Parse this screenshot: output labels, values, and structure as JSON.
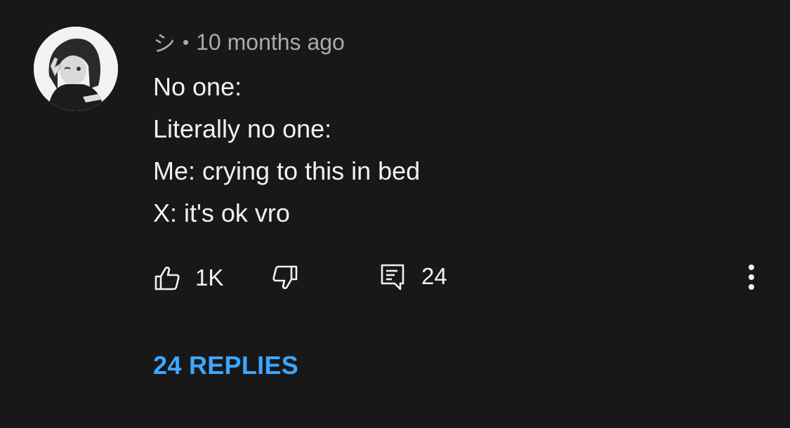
{
  "comment": {
    "author": "シ",
    "separator": "•",
    "timestamp": "10 months ago",
    "lines": [
      "No one:",
      "Literally no one:",
      "Me: crying to this in bed",
      "X: it's ok vro"
    ],
    "like_count": "1K",
    "reply_count": "24",
    "replies_link": "24 REPLIES"
  },
  "colors": {
    "background": "#181818",
    "text": "#f1f1f1",
    "meta_text": "#aaaaaa",
    "link": "#3ea6ff"
  },
  "icons": {
    "like": "thumbs-up-icon",
    "dislike": "thumbs-down-icon",
    "reply": "comment-icon",
    "more": "more-vertical-icon"
  }
}
